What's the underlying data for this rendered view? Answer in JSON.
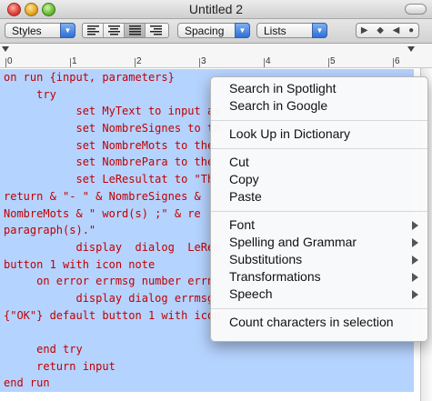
{
  "window": {
    "title": "Untitled 2"
  },
  "toolbar": {
    "styles_label": "Styles",
    "spacing_label": "Spacing",
    "lists_label": "Lists"
  },
  "ruler": {
    "numbers": [
      "0",
      "1",
      "2",
      "3",
      "4",
      "5",
      "6"
    ]
  },
  "editor": {
    "lines": [
      "on run {input, parameters}",
      "     try",
      "           set MyText to input as",
      "           set NombreSignes to th",
      "           set NombreMots to the",
      "           set NombrePara to the",
      "           set LeResultat to \"Th",
      "return & \"- \" & NombreSignes &",
      "NombreMots & \" word(s) ;\" & re",
      "paragraph(s).\"",
      "           display  dialog  LeRes",
      "button 1 with icon note",
      "     on error errmsg number errn",
      "           display dialog errmsg",
      "{\"OK\"} default button 1 with icon",
      "",
      "     end try",
      "     return input",
      "end run"
    ]
  },
  "context_menu": {
    "group1": [
      "Search in Spotlight",
      "Search in Google"
    ],
    "group2": [
      "Look Up in Dictionary"
    ],
    "group3": [
      "Cut",
      "Copy",
      "Paste"
    ],
    "group4": [
      "Font",
      "Spelling and Grammar",
      "Substitutions",
      "Transformations",
      "Speech"
    ],
    "group5": [
      "Count characters in selection"
    ]
  },
  "colors": {
    "selection": "#b5d3ff",
    "code_text": "#c00000",
    "accent": "#2d6fd6"
  }
}
